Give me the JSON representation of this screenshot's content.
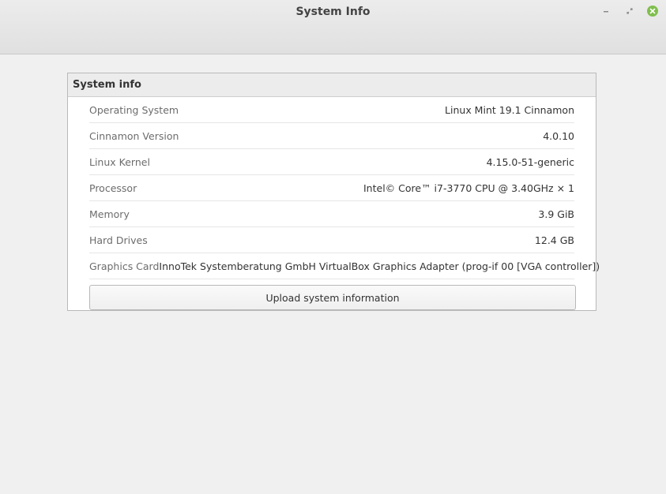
{
  "window": {
    "title": "System Info",
    "controls": [
      "minimize-icon",
      "maximize-icon",
      "close-icon"
    ],
    "close_color": "#7fbf4d"
  },
  "panel": {
    "header": "System info",
    "rows": [
      {
        "label": "Operating System",
        "value": "Linux Mint 19.1 Cinnamon"
      },
      {
        "label": "Cinnamon Version",
        "value": "4.0.10"
      },
      {
        "label": "Linux Kernel",
        "value": "4.15.0-51-generic"
      },
      {
        "label": "Processor",
        "value": "Intel© Core™ i7-3770 CPU @ 3.40GHz × 1"
      },
      {
        "label": "Memory",
        "value": "3.9 GiB"
      },
      {
        "label": "Hard Drives",
        "value": "12.4 GB"
      },
      {
        "label": "Graphics Card",
        "value": "InnoTek Systemberatung GmbH VirtualBox Graphics Adapter (prog-if 00 [VGA controller])"
      }
    ],
    "upload_label": "Upload system information"
  }
}
